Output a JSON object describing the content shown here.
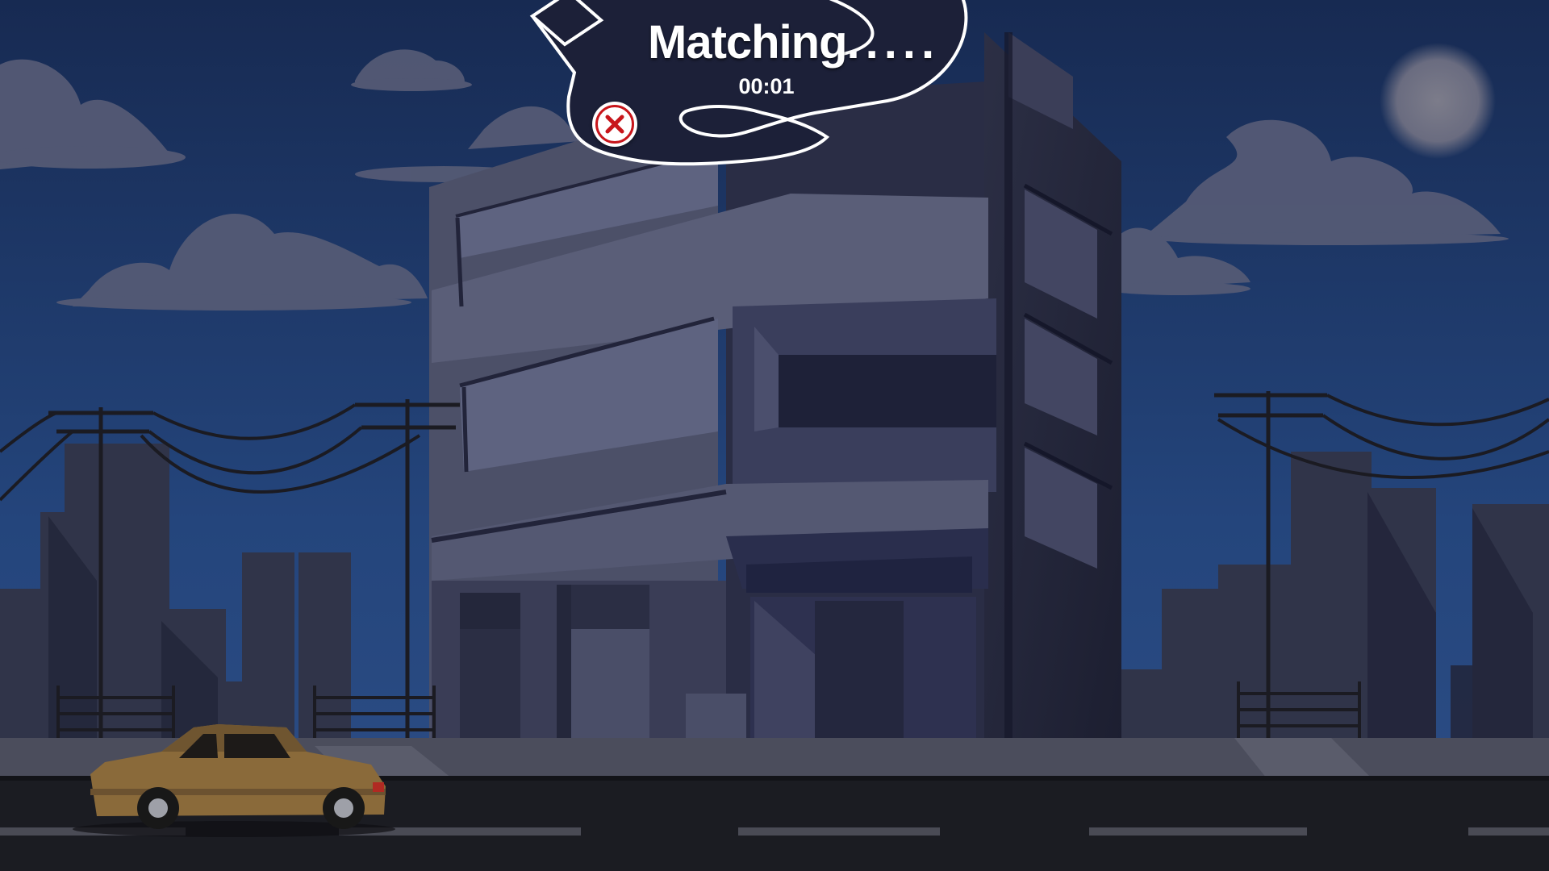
{
  "matching": {
    "label": "Matching",
    "dots": ".....",
    "timer": "00:01"
  },
  "icons": {
    "cancel": "close-circle-icon",
    "moon": "moon-icon"
  },
  "colors": {
    "sky_top": "#172a52",
    "sky_bottom": "#2a4a7f",
    "panel_fill": "#1c2038",
    "panel_outline": "#ffffff",
    "cancel_red": "#c8161b",
    "car_body": "#8a6a3a",
    "road": "#1b1c22"
  }
}
